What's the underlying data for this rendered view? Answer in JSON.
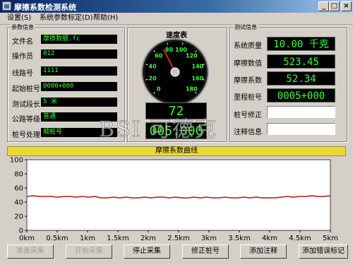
{
  "window": {
    "title": "摩擦系数检测系统",
    "controls": [
      "_",
      "□",
      "×"
    ]
  },
  "menu": [
    "设置(S)",
    "系统参数标定(D)",
    "帮助(H)"
  ],
  "params_group": {
    "title": "参数信息",
    "rows": [
      {
        "label": "文件名",
        "value": "摩擦数据.fc"
      },
      {
        "label": "操作员",
        "value": "012"
      },
      {
        "label": "线路号",
        "value": "1111"
      },
      {
        "label": "起始桩号",
        "value": "0000+000"
      },
      {
        "label": "测试段长",
        "value": "5 米"
      },
      {
        "label": "公路等级",
        "value": "普通"
      },
      {
        "label": "桩号处理",
        "value": "顺桩号"
      }
    ]
  },
  "speedometer": {
    "title": "速度表",
    "ticks": [
      "0",
      "20",
      "40",
      "60",
      "80",
      "100",
      "120",
      "140",
      "160",
      "180"
    ],
    "needle_value": 72,
    "max": 180,
    "speed_display": "72",
    "distance_display": "005.000"
  },
  "test_group": {
    "title": "测试信息",
    "rows": [
      {
        "label": "系统质量",
        "value": "10.00 千克"
      },
      {
        "label": "摩擦数值",
        "value": "523.45"
      },
      {
        "label": "摩擦系数",
        "value": "52.34"
      },
      {
        "label": "里程桩号",
        "value": "0005+000"
      },
      {
        "label": "桩号修正",
        "value": ""
      },
      {
        "label": "注释信息",
        "value": ""
      }
    ]
  },
  "watermark": "BSI 可德克",
  "chart_data": {
    "type": "line",
    "title": "摩擦系数曲线",
    "categories": [
      "0km",
      "0.5km",
      "1km",
      "1.5km",
      "2km",
      "2.5km",
      "3km",
      "3.5km",
      "4km",
      "4.5km",
      "5km"
    ],
    "y_ticks": [
      "0",
      "20",
      "40",
      "60",
      "80",
      "100"
    ],
    "ylim": [
      0,
      100
    ],
    "xlim": [
      0,
      5
    ],
    "grid": false,
    "series_color": "#b01818",
    "series": [
      {
        "values": [
          48,
          49,
          48,
          48,
          48,
          47,
          48,
          48,
          47,
          48,
          47,
          48,
          46,
          46,
          47,
          46,
          47,
          46,
          46,
          47,
          46,
          47,
          47,
          46,
          47,
          46,
          46,
          47,
          46,
          47,
          46,
          46,
          47,
          46,
          46,
          47,
          46,
          47,
          46,
          46,
          46,
          47,
          48,
          47,
          48,
          48,
          49,
          48,
          48,
          49
        ]
      }
    ]
  },
  "buttons": [
    {
      "label": "准备采集",
      "enabled": false
    },
    {
      "label": "开始采集",
      "enabled": false
    },
    {
      "label": "停止采集",
      "enabled": true
    },
    {
      "label": "修正桩号",
      "enabled": true
    },
    {
      "label": "添加注释",
      "enabled": true
    },
    {
      "label": "添加错误标记",
      "enabled": true
    }
  ]
}
